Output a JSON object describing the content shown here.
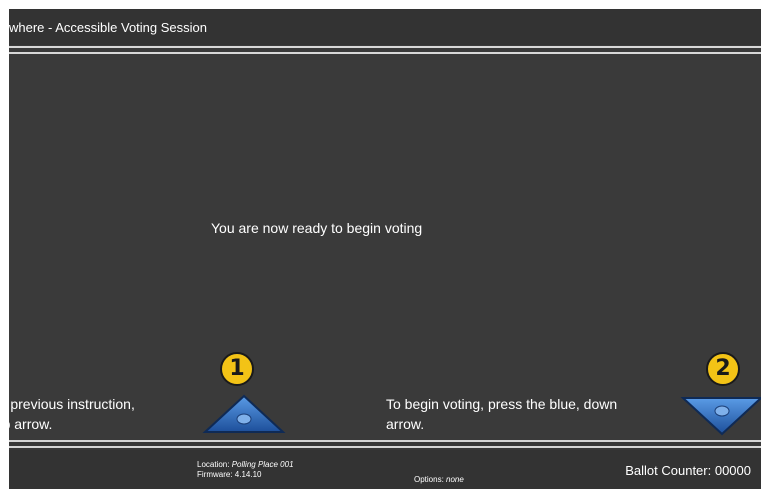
{
  "header": {
    "title": "where - Accessible Voting Session"
  },
  "main": {
    "message": "You are now ready to begin voting"
  },
  "instructions": {
    "previous_line1": "the previous instruction,",
    "previous_line2": ", up arrow.",
    "begin_line1": "To begin voting, press the blue, down",
    "begin_line2": "arrow."
  },
  "badges": {
    "one": "1",
    "two": "2"
  },
  "footer": {
    "left_glyph": "]",
    "location_label": "Location:",
    "location_value": "Polling Place 001",
    "firmware_label": "Firmware:",
    "firmware_value": "4.14.10",
    "options_label": "Options:",
    "options_value": "none",
    "ballot_counter": "Ballot Counter: 00000"
  },
  "colors": {
    "background": "#3a3a3a",
    "badge": "#f3c316",
    "arrow_blue": "#2f6fc0"
  },
  "icons": {
    "previous": "up-arrow-icon",
    "next": "down-arrow-icon"
  }
}
